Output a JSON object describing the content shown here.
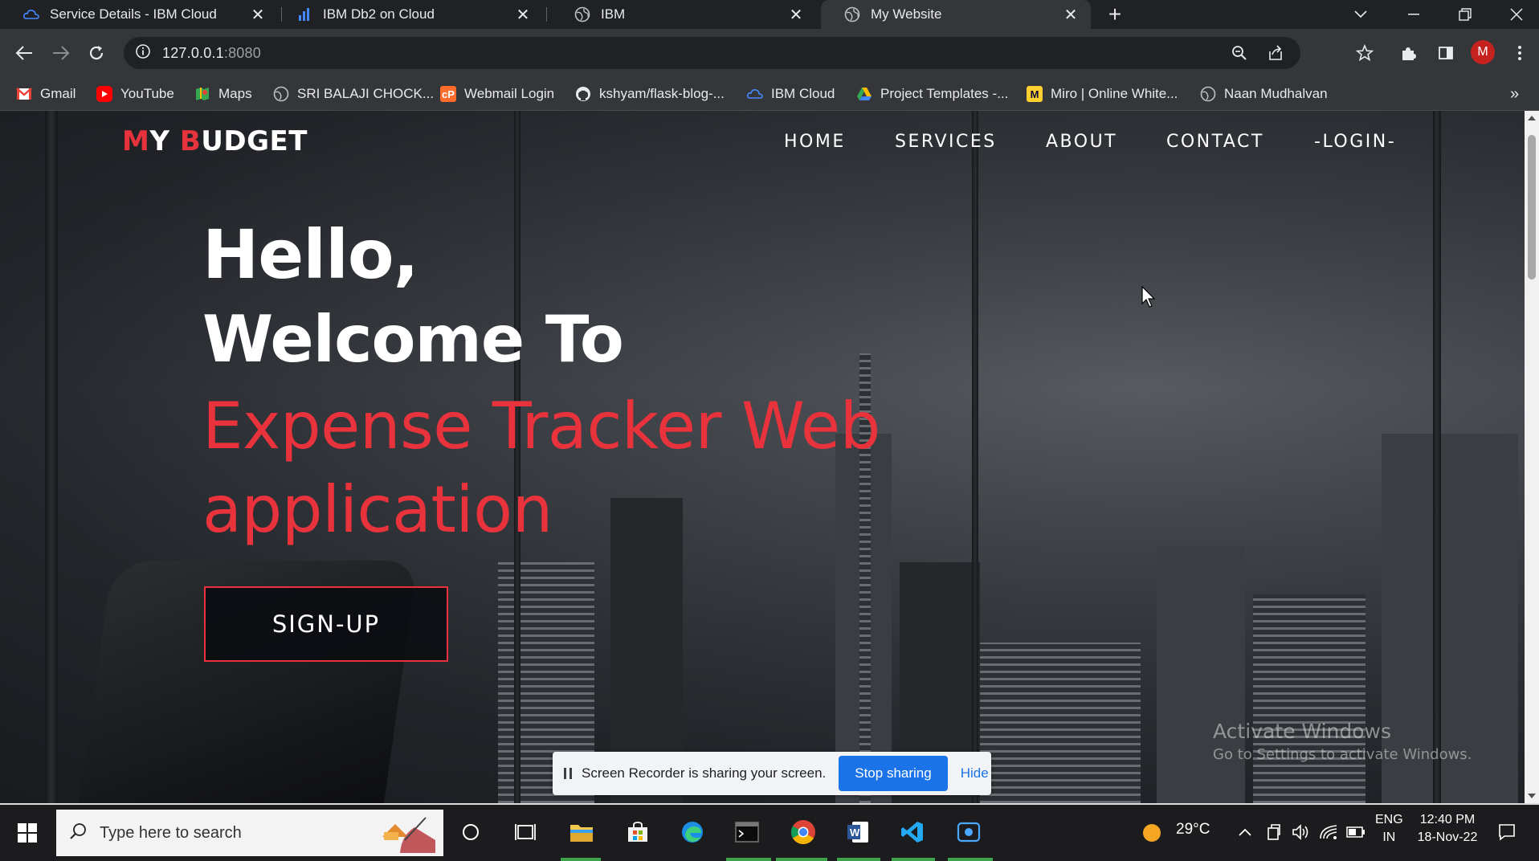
{
  "browser": {
    "tabs": [
      {
        "title": "Service Details - IBM Cloud",
        "icon": "ibm-cloud-icon",
        "active": false
      },
      {
        "title": "IBM Db2 on Cloud",
        "icon": "db2-icon",
        "active": false
      },
      {
        "title": "IBM",
        "icon": "globe-icon",
        "active": false
      },
      {
        "title": "My Website",
        "icon": "globe-icon",
        "active": true
      }
    ],
    "url": {
      "host": "127.0.0.1",
      "port": ":8080"
    },
    "profile_initial": "M",
    "bookmarks": [
      {
        "label": "Gmail",
        "icon": "gmail-icon"
      },
      {
        "label": "YouTube",
        "icon": "youtube-icon"
      },
      {
        "label": "Maps",
        "icon": "maps-icon"
      },
      {
        "label": "SRI BALAJI CHOCK...",
        "icon": "globe-icon"
      },
      {
        "label": "Webmail Login",
        "icon": "webmail-icon"
      },
      {
        "label": "kshyam/flask-blog-...",
        "icon": "github-icon"
      },
      {
        "label": "IBM Cloud",
        "icon": "ibm-cloud-icon"
      },
      {
        "label": "Project Templates -...",
        "icon": "drive-icon"
      },
      {
        "label": "Miro | Online White...",
        "icon": "miro-icon"
      },
      {
        "label": "Naan Mudhalvan",
        "icon": "globe-icon"
      }
    ]
  },
  "page": {
    "brand": {
      "m": "M",
      "y": "Y ",
      "b": "B",
      "udget": "UDGET"
    },
    "nav": [
      "HOME",
      "SERVICES",
      "ABOUT",
      "CONTACT",
      "-LOGIN-"
    ],
    "hero": {
      "line1": "Hello,",
      "line2": "Welcome To",
      "line3": "Expense Tracker Web",
      "line4": "application"
    },
    "signup_label": "SIGN-UP",
    "accent_color": "#e8323c",
    "watermark": {
      "title": "Activate Windows",
      "subtitle": "Go to Settings to activate Windows."
    }
  },
  "share_banner": {
    "message": "Screen Recorder is sharing your screen.",
    "stop_label": "Stop sharing",
    "hide_label": "Hide"
  },
  "taskbar": {
    "search_placeholder": "Type here to search",
    "weather": "29°C",
    "language": "ENG",
    "region": "IN",
    "time": "12:40 PM",
    "date": "18-Nov-22"
  }
}
